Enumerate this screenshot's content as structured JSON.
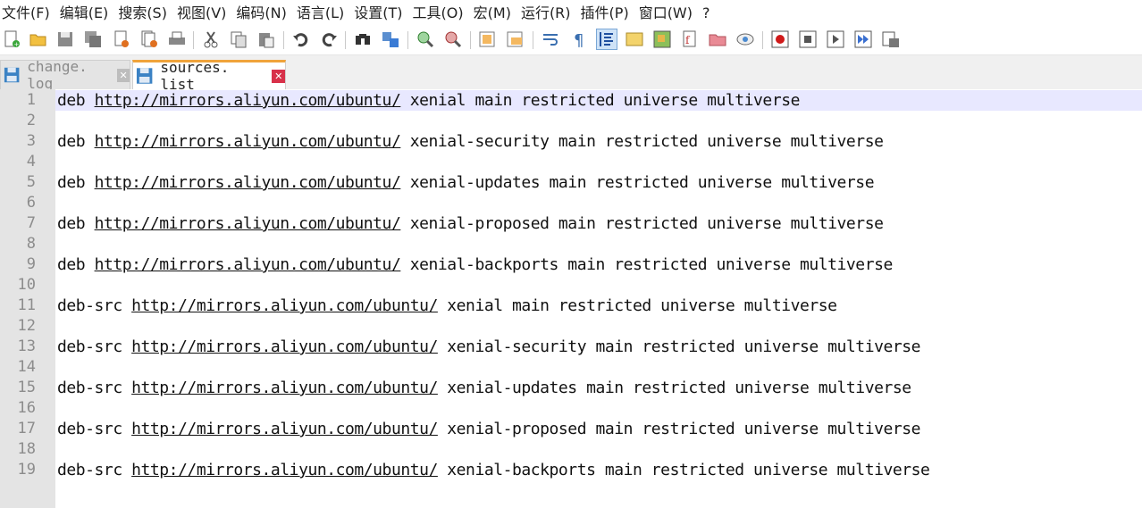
{
  "menu": [
    "文件(F)",
    "编辑(E)",
    "搜索(S)",
    "视图(V)",
    "编码(N)",
    "语言(L)",
    "设置(T)",
    "工具(O)",
    "宏(M)",
    "运行(R)",
    "插件(P)",
    "窗口(W)",
    "?"
  ],
  "toolbar_icons": [
    "new-file-icon",
    "open-file-icon",
    "save-icon",
    "save-all-icon",
    "close-icon",
    "close-all-icon",
    "print-icon",
    "cut-icon",
    "copy-icon",
    "paste-icon",
    "undo-icon",
    "redo-icon",
    "find-icon",
    "replace-icon",
    "zoom-in-icon",
    "zoom-out-icon",
    "sync-vertical-icon",
    "sync-horizontal-icon",
    "word-wrap-icon",
    "show-all-characters-icon",
    "indent-guide-icon",
    "user-language-icon",
    "document-map-icon",
    "function-list-icon",
    "folder-workspace-icon",
    "monitoring-icon",
    "record-macro-icon",
    "stop-record-icon",
    "play-macro-icon",
    "run-macro-multiple-icon",
    "save-macro-icon"
  ],
  "tabs": [
    {
      "label": "change. log",
      "active": false
    },
    {
      "label": "sources. list",
      "active": true
    }
  ],
  "colors": {
    "accent_tab": "#f0a33b",
    "close_active": "#d8314a",
    "current_line": "#e8e8ff"
  },
  "lines": [
    {
      "n": "1",
      "pre": "deb ",
      "url": "http://mirrors.aliyun.com/ubuntu/",
      "post": " xenial main restricted universe multiverse"
    },
    {
      "n": "2",
      "pre": "",
      "url": "",
      "post": ""
    },
    {
      "n": "3",
      "pre": "deb ",
      "url": "http://mirrors.aliyun.com/ubuntu/",
      "post": " xenial-security main restricted universe multiverse"
    },
    {
      "n": "4",
      "pre": "",
      "url": "",
      "post": ""
    },
    {
      "n": "5",
      "pre": "deb ",
      "url": "http://mirrors.aliyun.com/ubuntu/",
      "post": " xenial-updates main restricted universe multiverse"
    },
    {
      "n": "6",
      "pre": "",
      "url": "",
      "post": ""
    },
    {
      "n": "7",
      "pre": "deb ",
      "url": "http://mirrors.aliyun.com/ubuntu/",
      "post": " xenial-proposed main restricted universe multiverse"
    },
    {
      "n": "8",
      "pre": "",
      "url": "",
      "post": ""
    },
    {
      "n": "9",
      "pre": "deb ",
      "url": "http://mirrors.aliyun.com/ubuntu/",
      "post": " xenial-backports main restricted universe multiverse"
    },
    {
      "n": "10",
      "pre": "",
      "url": "",
      "post": ""
    },
    {
      "n": "11",
      "pre": "deb-src ",
      "url": "http://mirrors.aliyun.com/ubuntu/",
      "post": " xenial main restricted universe multiverse"
    },
    {
      "n": "12",
      "pre": "",
      "url": "",
      "post": ""
    },
    {
      "n": "13",
      "pre": "deb-src ",
      "url": "http://mirrors.aliyun.com/ubuntu/",
      "post": " xenial-security main restricted universe multiverse"
    },
    {
      "n": "14",
      "pre": "",
      "url": "",
      "post": ""
    },
    {
      "n": "15",
      "pre": "deb-src ",
      "url": "http://mirrors.aliyun.com/ubuntu/",
      "post": " xenial-updates main restricted universe multiverse"
    },
    {
      "n": "16",
      "pre": "",
      "url": "",
      "post": ""
    },
    {
      "n": "17",
      "pre": "deb-src ",
      "url": "http://mirrors.aliyun.com/ubuntu/",
      "post": " xenial-proposed main restricted universe multiverse"
    },
    {
      "n": "18",
      "pre": "",
      "url": "",
      "post": ""
    },
    {
      "n": "19",
      "pre": "deb-src ",
      "url": "http://mirrors.aliyun.com/ubuntu/",
      "post": " xenial-backports main restricted universe multiverse"
    }
  ]
}
